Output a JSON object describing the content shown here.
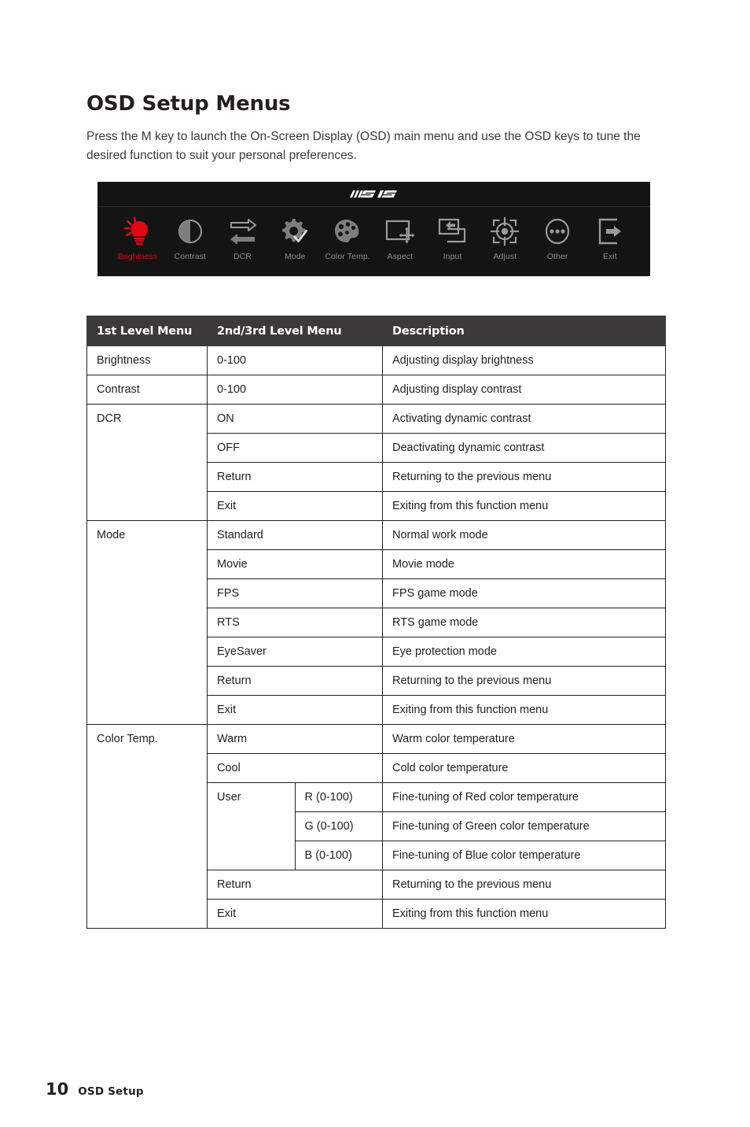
{
  "document": {
    "title": "OSD Setup Menus",
    "intro": "Press the M key to launch the On-Screen Display (OSD) main menu and use the OSD keys to tune the desired function to suit your personal preferences."
  },
  "osd_banner": {
    "brand": "MSI",
    "brand_logo_icon": "msi-logo-icon",
    "active_item": "Brightness",
    "active_color": "#e30613",
    "background_color": "#141414",
    "label_color": "#8d8d8d",
    "items": [
      {
        "label": "Brightness",
        "icon": "brightness-bulb-icon",
        "active": true
      },
      {
        "label": "Contrast",
        "icon": "contrast-circle-icon",
        "active": false
      },
      {
        "label": "DCR",
        "icon": "dcr-arrows-icon",
        "active": false
      },
      {
        "label": "Mode",
        "icon": "mode-gear-check-icon",
        "active": false
      },
      {
        "label": "Color Temp.",
        "icon": "color-palette-icon",
        "active": false
      },
      {
        "label": "Aspect",
        "icon": "aspect-resize-icon",
        "active": false
      },
      {
        "label": "Input",
        "icon": "input-source-icon",
        "active": false
      },
      {
        "label": "Adjust",
        "icon": "adjust-crosshair-icon",
        "active": false
      },
      {
        "label": "Other",
        "icon": "other-ellipsis-icon",
        "active": false
      },
      {
        "label": "Exit",
        "icon": "exit-arrow-icon",
        "active": false
      }
    ]
  },
  "table": {
    "headers": {
      "col1": "1st Level Menu",
      "col2": "2nd/3rd Level Menu",
      "col3": "Description"
    },
    "rows": [
      {
        "level1": "Brightness",
        "level2": "0-100",
        "level3": "",
        "description": "Adjusting display brightness"
      },
      {
        "level1": "Contrast",
        "level2": "0-100",
        "level3": "",
        "description": "Adjusting display contrast"
      },
      {
        "level1": "DCR",
        "level2": "ON",
        "level3": "",
        "description": "Activating dynamic contrast"
      },
      {
        "level1": "",
        "level2": "OFF",
        "level3": "",
        "description": "Deactivating dynamic contrast"
      },
      {
        "level1": "",
        "level2": "Return",
        "level3": "",
        "description": "Returning to the previous menu"
      },
      {
        "level1": "",
        "level2": "Exit",
        "level3": "",
        "description": "Exiting from this function menu"
      },
      {
        "level1": "Mode",
        "level2": "Standard",
        "level3": "",
        "description": "Normal work mode"
      },
      {
        "level1": "",
        "level2": "Movie",
        "level3": "",
        "description": "Movie mode"
      },
      {
        "level1": "",
        "level2": "FPS",
        "level3": "",
        "description": "FPS game mode"
      },
      {
        "level1": "",
        "level2": "RTS",
        "level3": "",
        "description": "RTS game mode"
      },
      {
        "level1": "",
        "level2": "EyeSaver",
        "level3": "",
        "description": "Eye protection mode"
      },
      {
        "level1": "",
        "level2": "Return",
        "level3": "",
        "description": "Returning to the previous menu"
      },
      {
        "level1": "",
        "level2": "Exit",
        "level3": "",
        "description": "Exiting from this function menu"
      },
      {
        "level1": "Color Temp.",
        "level2": "Warm",
        "level3": "",
        "description": "Warm color temperature"
      },
      {
        "level1": "",
        "level2": "Cool",
        "level3": "",
        "description": "Cold color temperature"
      },
      {
        "level1": "",
        "level2": "User",
        "level3": "R (0-100)",
        "description": "Fine-tuning of Red color temperature"
      },
      {
        "level1": "",
        "level2": "",
        "level3": "G (0-100)",
        "description": "Fine-tuning of Green color temperature"
      },
      {
        "level1": "",
        "level2": "",
        "level3": "B (0-100)",
        "description": "Fine-tuning of Blue color temperature"
      },
      {
        "level1": "",
        "level2": "Return",
        "level3": "",
        "description": "Returning to the previous menu"
      },
      {
        "level1": "",
        "level2": "Exit",
        "level3": "",
        "description": "Exiting from this function menu"
      }
    ]
  },
  "footer": {
    "page_number": "10",
    "section": "OSD Setup"
  }
}
